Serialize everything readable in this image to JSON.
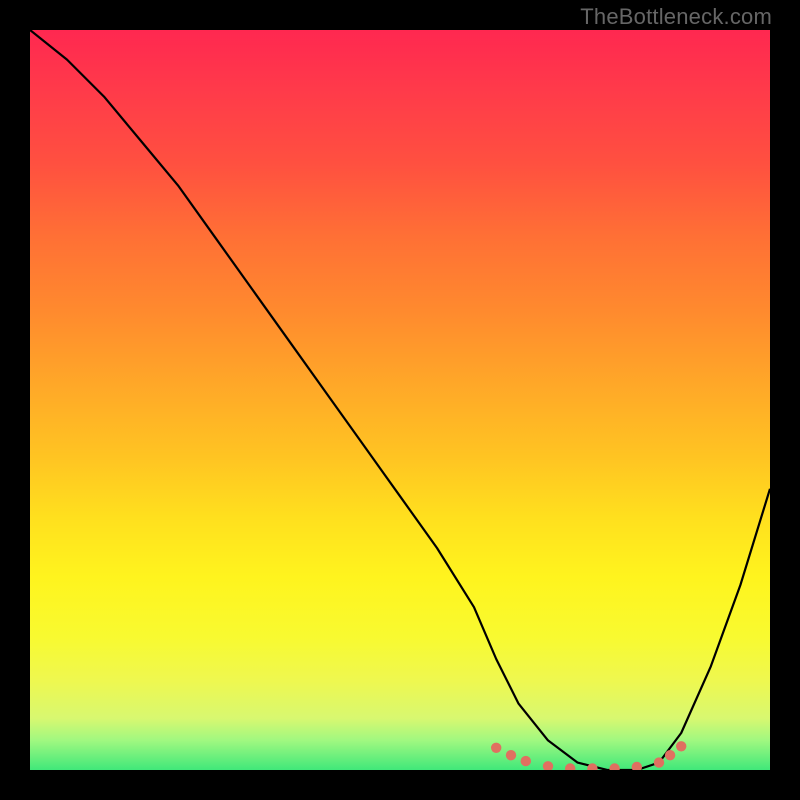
{
  "watermark": "TheBottleneck.com",
  "chart_data": {
    "type": "line",
    "title": "",
    "xlabel": "",
    "ylabel": "",
    "xlim": [
      0,
      100
    ],
    "ylim": [
      0,
      100
    ],
    "series": [
      {
        "name": "bottleneck-curve",
        "x": [
          0,
          5,
          10,
          15,
          20,
          25,
          30,
          35,
          40,
          45,
          50,
          55,
          60,
          63,
          66,
          70,
          74,
          78,
          82,
          85,
          88,
          92,
          96,
          100
        ],
        "values": [
          100,
          96,
          91,
          85,
          79,
          72,
          65,
          58,
          51,
          44,
          37,
          30,
          22,
          15,
          9,
          4,
          1,
          0,
          0,
          1,
          5,
          14,
          25,
          38
        ]
      }
    ],
    "markers": {
      "name": "optimal-band",
      "color": "#e07060",
      "points": [
        {
          "x": 63,
          "y": 3
        },
        {
          "x": 65,
          "y": 2
        },
        {
          "x": 67,
          "y": 1.2
        },
        {
          "x": 70,
          "y": 0.5
        },
        {
          "x": 73,
          "y": 0.2
        },
        {
          "x": 76,
          "y": 0.2
        },
        {
          "x": 79,
          "y": 0.2
        },
        {
          "x": 82,
          "y": 0.4
        },
        {
          "x": 85,
          "y": 1.0
        },
        {
          "x": 86.5,
          "y": 2.0
        },
        {
          "x": 88,
          "y": 3.2
        }
      ]
    },
    "gradient_stops": [
      {
        "pct": 0,
        "color": "#ff2850"
      },
      {
        "pct": 8,
        "color": "#ff3a4a"
      },
      {
        "pct": 18,
        "color": "#ff5040"
      },
      {
        "pct": 28,
        "color": "#ff7035"
      },
      {
        "pct": 38,
        "color": "#ff8a2e"
      },
      {
        "pct": 48,
        "color": "#ffa828"
      },
      {
        "pct": 58,
        "color": "#ffc522"
      },
      {
        "pct": 66,
        "color": "#ffe01e"
      },
      {
        "pct": 74,
        "color": "#fff41e"
      },
      {
        "pct": 82,
        "color": "#f8fa30"
      },
      {
        "pct": 88,
        "color": "#eef850"
      },
      {
        "pct": 93,
        "color": "#d8f870"
      },
      {
        "pct": 96,
        "color": "#a0f880"
      },
      {
        "pct": 100,
        "color": "#40e87a"
      }
    ]
  }
}
